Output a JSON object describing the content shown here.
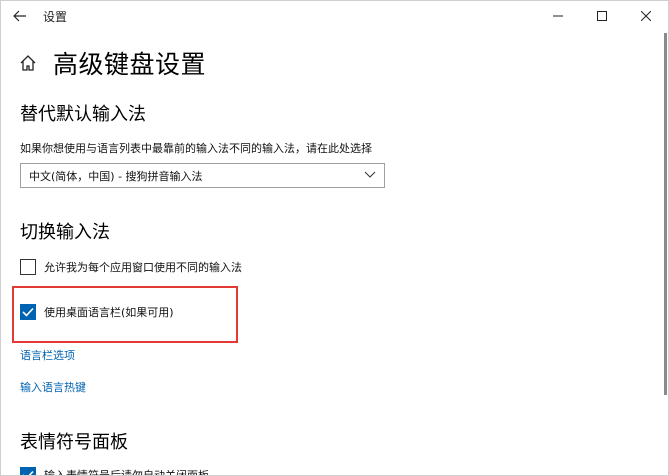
{
  "titlebar": {
    "app_title": "设置",
    "back_icon": "arrow-left-icon",
    "controls": [
      "minimize-icon",
      "maximize-icon",
      "close-icon"
    ]
  },
  "page": {
    "title": "高级键盘设置",
    "home_icon": "home-icon"
  },
  "sections": {
    "default_ime": {
      "title": "替代默认输入法",
      "description": "如果你想使用与语言列表中最靠前的输入法不同的输入法，请在此处选择",
      "select_value": "中文(简体，中国) - 搜狗拼音输入法"
    },
    "switch_ime": {
      "title": "切换输入法",
      "checkbox_per_app": {
        "label": "允许我为每个应用窗口使用不同的输入法",
        "checked": false
      },
      "checkbox_desktop_bar": {
        "label": "使用桌面语言栏(如果可用)",
        "checked": true
      },
      "link_langbar_options": "语言栏选项",
      "link_hotkeys": "输入语言热键"
    },
    "emoji_panel": {
      "title": "表情符号面板",
      "checkbox_autoclose": {
        "label": "输入表情符号后请勿自动关闭面板",
        "checked": true
      }
    }
  },
  "colors": {
    "accent": "#0063b1",
    "highlight_border": "#e53935"
  }
}
